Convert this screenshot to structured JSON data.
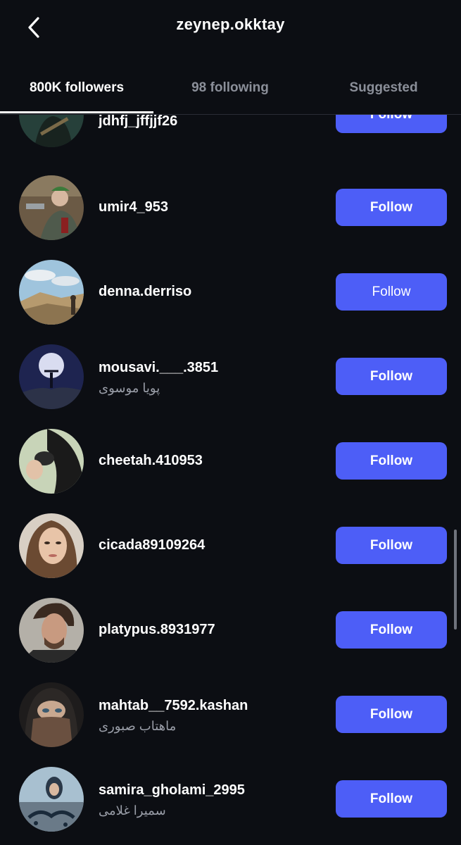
{
  "header": {
    "title": "zeynep.okktay",
    "back_icon": "chevron-left-icon"
  },
  "tabs": [
    {
      "label": "800K followers",
      "active": true
    },
    {
      "label": "98 following",
      "active": false
    },
    {
      "label": "Suggested",
      "active": false
    }
  ],
  "colors": {
    "background": "#0c0e13",
    "accent": "#4d5ef7",
    "muted_text": "#8b8f99"
  },
  "followers": [
    {
      "username": "jdhfj_jffjjf26",
      "display_name": "",
      "button": "Follow"
    },
    {
      "username": "umir4_953",
      "display_name": "",
      "button": "Follow"
    },
    {
      "username": "denna.derriso",
      "display_name": "",
      "button": "Follow"
    },
    {
      "username": "mousavi.___.3851",
      "display_name": "پویا موسوی",
      "button": "Follow"
    },
    {
      "username": "cheetah.410953",
      "display_name": "",
      "button": "Follow"
    },
    {
      "username": "cicada89109264",
      "display_name": "",
      "button": "Follow"
    },
    {
      "username": "platypus.8931977",
      "display_name": "",
      "button": "Follow"
    },
    {
      "username": "mahtab__7592.kashan",
      "display_name": "ماهتاب صبوری",
      "button": "Follow"
    },
    {
      "username": "samira_gholami_2995",
      "display_name": "سمیرا غلامی",
      "button": "Follow"
    }
  ]
}
